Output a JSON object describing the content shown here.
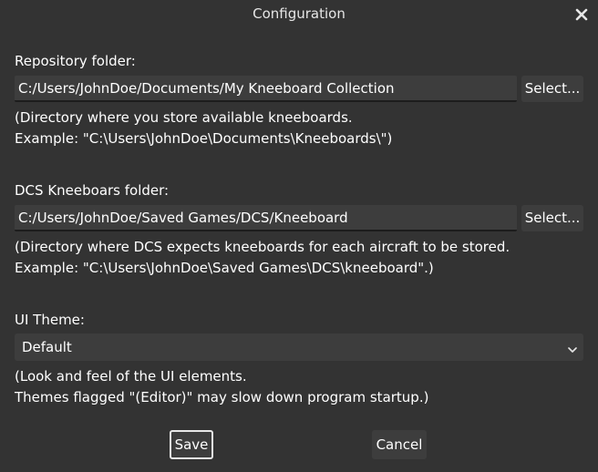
{
  "window": {
    "title": "Configuration",
    "close_icon": "close-icon"
  },
  "repository": {
    "label": "Repository folder:",
    "value": "C:/Users/JohnDoe/Documents/My Kneeboard Collection",
    "select_label": "Select...",
    "help_line1": "(Directory where you store available kneeboards.",
    "help_line2": "Example: \"C:\\Users\\JohnDoe\\Documents\\Kneeboards\\\")"
  },
  "dcs": {
    "label": "DCS Kneeboars folder:",
    "value": "C:/Users/JohnDoe/Saved Games/DCS/Kneeboard",
    "select_label": "Select...",
    "help_line1": "(Directory where DCS expects kneeboards for each aircraft to be stored.",
    "help_line2": "Example: \"C:\\Users\\JohnDoe\\Saved Games\\DCS\\kneeboard\".)"
  },
  "theme": {
    "label": "UI Theme:",
    "selected": "Default",
    "help_line1": "(Look and feel of the UI elements.",
    "help_line2": "Themes flagged \"(Editor)\" may slow down program startup.)"
  },
  "buttons": {
    "save": "Save",
    "cancel": "Cancel"
  },
  "colors": {
    "background": "#333333",
    "control": "#3d3d3d",
    "text": "#ffffff"
  }
}
